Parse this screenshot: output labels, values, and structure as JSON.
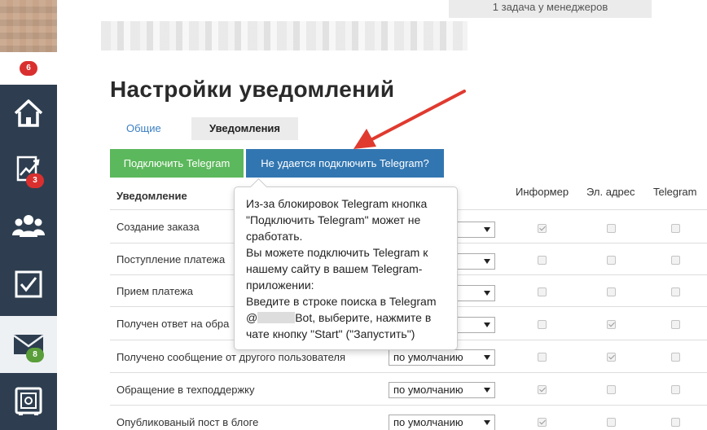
{
  "sidebar": {
    "avatar_badge": "6",
    "items": [
      {
        "name": "home",
        "icon": "home-icon",
        "badge": null
      },
      {
        "name": "analytics",
        "icon": "chart-icon",
        "badge": "3",
        "badge_color": "#d9302f"
      },
      {
        "name": "users",
        "icon": "users-icon",
        "badge": null
      },
      {
        "name": "tasks",
        "icon": "checkbox-icon",
        "badge": null
      },
      {
        "name": "messages",
        "icon": "envelope-icon",
        "badge": "8",
        "badge_color": "#5a9e3a",
        "active": true
      },
      {
        "name": "safe",
        "icon": "safe-icon",
        "badge": null
      }
    ]
  },
  "header": {
    "task_notice": "1 задача у менеджеров"
  },
  "page": {
    "title": "Настройки уведомлений",
    "tabs": [
      {
        "label": "Общие",
        "active": false
      },
      {
        "label": "Уведомления",
        "active": true
      }
    ]
  },
  "buttons": {
    "connect_telegram": "Подключить Telegram",
    "cant_connect": "Не удается подключить Telegram?"
  },
  "table": {
    "columns": {
      "notification": "Уведомление",
      "informer": "Информер",
      "email": "Эл. адрес",
      "telegram": "Telegram"
    },
    "rows": [
      {
        "label": "Создание заказа",
        "select": "",
        "informer": true,
        "email": false,
        "telegram": false
      },
      {
        "label": "Поступление платежа",
        "select": "",
        "informer": false,
        "email": false,
        "telegram": false
      },
      {
        "label": "Прием платежа",
        "select": "",
        "informer": false,
        "email": false,
        "telegram": false
      },
      {
        "label": "Получен ответ на обра",
        "select": "",
        "informer": false,
        "email": true,
        "telegram": false
      },
      {
        "label": "Получено сообщение от другого пользователя",
        "select": "по умолчанию",
        "informer": false,
        "email": true,
        "telegram": false
      },
      {
        "label": "Обращение в техподдержку",
        "select": "по умолчанию",
        "informer": true,
        "email": false,
        "telegram": false
      },
      {
        "label": "Опубликованый пост в блоге",
        "select": "по умолчанию",
        "informer": true,
        "email": false,
        "telegram": false
      }
    ]
  },
  "tooltip": {
    "line1": "Из-за блокировок Telegram кнопка \"Подключить Telegram\" может не сработать.",
    "line2": "Вы можете подключить Telegram к нашему сайту в вашем Telegram-приложении:",
    "line3_prefix": "Введите в строке поиска в Telegram @",
    "line3_suffix": "Bot, выберите, нажмите в чате кнопку \"Start\" (\"Запустить\")"
  },
  "colors": {
    "sidebar": "#2e3e50",
    "green_button": "#5cb85c",
    "blue_button": "#3276b1",
    "annotation_arrow": "#e03a2f"
  }
}
